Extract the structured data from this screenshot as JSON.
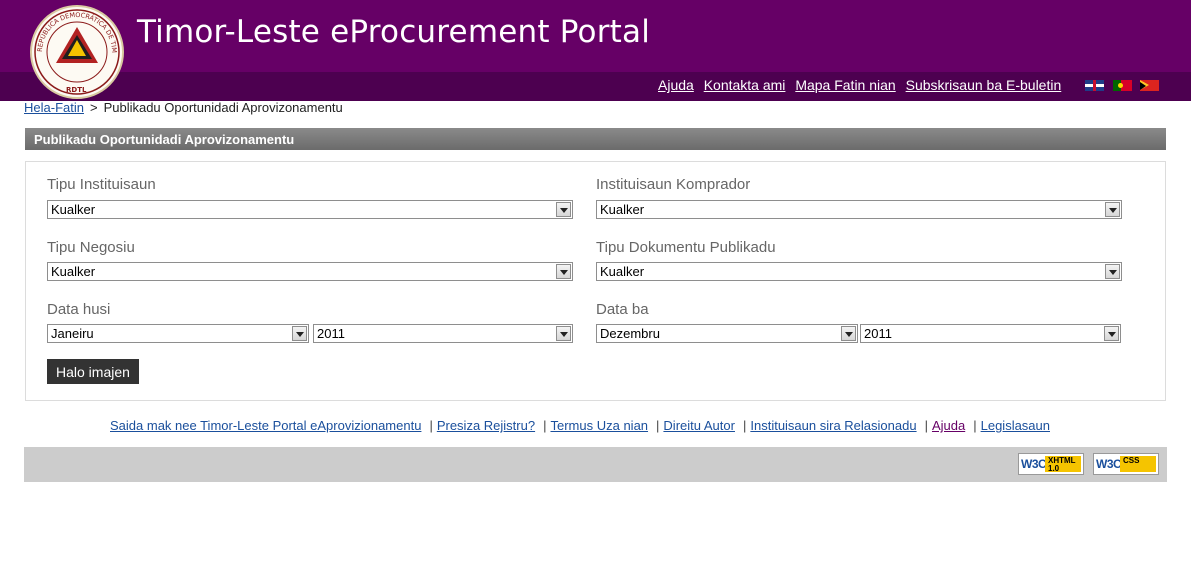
{
  "header": {
    "title": "Timor-Leste eProcurement Portal",
    "seal_text": "REPÚBLICA DEMOCRÁTICA DE TIMOR LESTE",
    "seal_initials": "RDTL",
    "links": [
      "Ajuda",
      "Kontakta ami",
      "Mapa Fatin nian",
      "Subskrisaun ba E-buletin"
    ],
    "flags": [
      "flag-uk-icon",
      "flag-portugal-icon",
      "flag-timor-leste-icon"
    ]
  },
  "breadcrumb": {
    "home": "Hela-Fatin",
    "separator": ">",
    "current": "Publikadu Oportunidadi Aprovizonamentu"
  },
  "panel": {
    "title": "Publikadu Oportunidadi Aprovizonamentu",
    "fields": {
      "tipu_instituisaun": {
        "label": "Tipu Instituisaun",
        "value": "Kualker"
      },
      "instituisaun_komprador": {
        "label": "Instituisaun Komprador",
        "value": "Kualker"
      },
      "tipu_negosiu": {
        "label": "Tipu Negosiu",
        "value": "Kualker"
      },
      "tipu_dokumentu": {
        "label": "Tipu Dokumentu Publikadu",
        "value": "Kualker"
      },
      "data_husi": {
        "label": "Data husi",
        "month": "Janeiru",
        "year": "2011"
      },
      "data_ba": {
        "label": "Data ba",
        "month": "Dezembru",
        "year": "2011"
      }
    },
    "search_button": "Halo imajen"
  },
  "footer": {
    "links": [
      "Saida mak nee Timor-Leste Portal eAprovizionamentu",
      "Presiza Rejistru?",
      "Termus Uza nian",
      "Direitu Autor",
      "Instituisaun sira Relasionadu",
      "Ajuda",
      "Legislasaun"
    ],
    "separator": "|",
    "badges": [
      {
        "org": "W3C",
        "tag": "XHTML 1.0"
      },
      {
        "org": "W3C",
        "tag": "CSS"
      }
    ]
  },
  "colors": {
    "header_bg": "#660066",
    "header_sub_bg": "#4d0050",
    "panel_head_bg": "#777777",
    "button_bg": "#333333",
    "link": "#1a4f9c",
    "footer_bar": "#cccccc"
  }
}
